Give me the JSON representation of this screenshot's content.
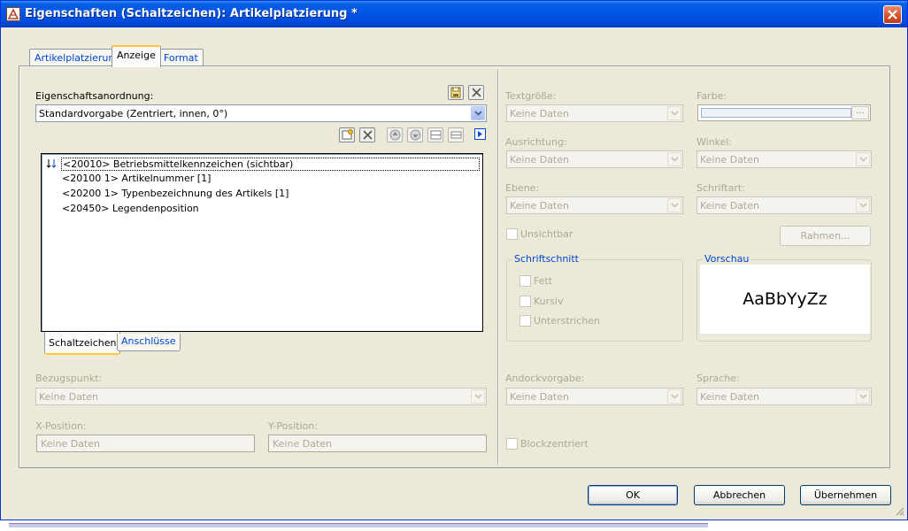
{
  "window": {
    "title": "Eigenschaften (Schaltzeichen): Artikelplatzierung *"
  },
  "tabs": [
    {
      "label": "Artikelplatzierung"
    },
    {
      "label": "Anzeige"
    },
    {
      "label": "Format"
    }
  ],
  "left": {
    "arrangement_label": "Eigenschaftsanordnung:",
    "arrangement_value": "Standardvorgabe (Zentriert, innen, 0°)",
    "list_items": [
      "<20010> Betriebsmittelkennzeichen (sichtbar)",
      "<20100 1> Artikelnummer [1]",
      "<20200 1> Typenbezeichnung des Artikels [1]",
      "<20450> Legendenposition"
    ],
    "list_tabs": [
      "Schaltzeichen",
      "Anschlüsse"
    ],
    "reference_label": "Bezugspunkt:",
    "reference_value": "Keine Daten",
    "xpos_label": "X-Position:",
    "xpos_value": "Keine Daten",
    "ypos_label": "Y-Position:",
    "ypos_value": "Keine Daten"
  },
  "right": {
    "textsize_label": "Textgröße:",
    "textsize_value": "Keine Daten",
    "color_label": "Farbe:",
    "color_button": "...",
    "align_label": "Ausrichtung:",
    "align_value": "Keine Daten",
    "angle_label": "Winkel:",
    "angle_value": "Keine Daten",
    "layer_label": "Ebene:",
    "layer_value": "Keine Daten",
    "font_label": "Schriftart:",
    "font_value": "Keine Daten",
    "invisible_label": "Unsichtbar",
    "frame_button": "Rahmen...",
    "fontstyle_group": "Schriftschnitt",
    "bold_label": "Fett",
    "italic_label": "Kursiv",
    "underline_label": "Unterstrichen",
    "preview_group": "Vorschau",
    "preview_text": "AaBbYyZz",
    "dock_label": "Andockvorgabe:",
    "dock_value": "Keine Daten",
    "language_label": "Sprache:",
    "language_value": "Keine Daten",
    "blockcentered_label": "Blockzentriert"
  },
  "buttons": {
    "ok": "OK",
    "cancel": "Abbrechen",
    "apply": "Übernehmen"
  }
}
